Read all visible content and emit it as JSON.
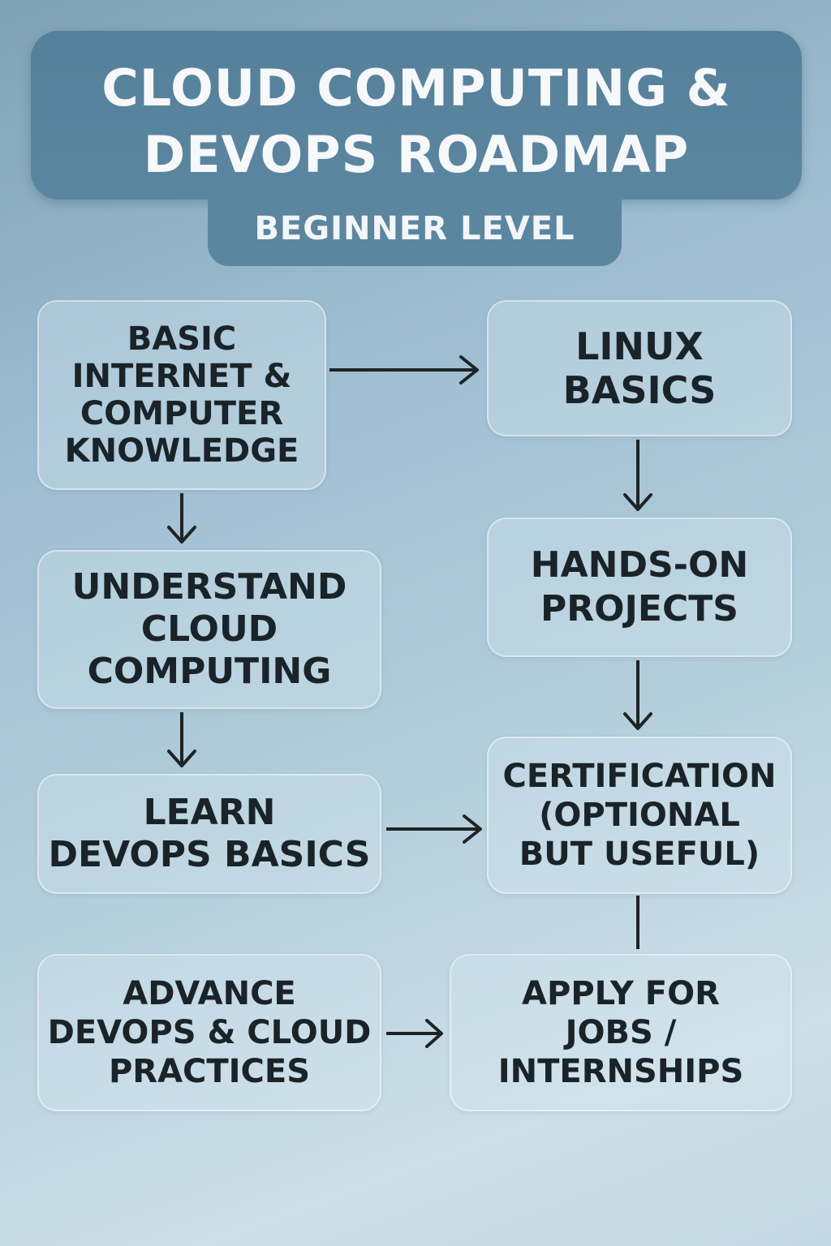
{
  "header": {
    "title_line1": "CLOUD COMPUTING &",
    "title_line2": "DEVOPS ROADMAP",
    "subtitle": "BEGINNER LEVEL"
  },
  "nodes": [
    {
      "id": "basic",
      "lines": [
        "BASIC",
        "INTERNET &",
        "COMPUTER",
        "KNOWLEDGE"
      ]
    },
    {
      "id": "linux",
      "lines": [
        "LINUX",
        "BASICS"
      ]
    },
    {
      "id": "cloud",
      "lines": [
        "UNDERSTAND",
        "CLOUD",
        "COMPUTING"
      ]
    },
    {
      "id": "handson",
      "lines": [
        "HANDS-ON",
        "PROJECTS"
      ]
    },
    {
      "id": "devops",
      "lines": [
        "LEARN",
        "DEVOPS BASICS"
      ]
    },
    {
      "id": "cert",
      "lines": [
        "CERTIFICATION",
        "(OPTIONAL",
        "BUT USEFUL)"
      ]
    },
    {
      "id": "advance",
      "lines": [
        "ADVANCE",
        "DEVOPS & CLOUD",
        "PRACTICES"
      ]
    },
    {
      "id": "apply",
      "lines": [
        "APPLY FOR",
        "JOBS /",
        "INTERNSHIPS"
      ]
    }
  ],
  "connections": [
    {
      "from": "basic",
      "to": "linux",
      "arrow": true
    },
    {
      "from": "basic",
      "to": "cloud",
      "arrow": true
    },
    {
      "from": "linux",
      "to": "handson",
      "arrow": true
    },
    {
      "from": "cloud",
      "to": "devops",
      "arrow": true
    },
    {
      "from": "handson",
      "to": "cert",
      "arrow": true
    },
    {
      "from": "devops",
      "to": "cert",
      "arrow": true
    },
    {
      "from": "cert",
      "to": "apply",
      "arrow": false
    },
    {
      "from": "advance",
      "to": "apply",
      "arrow": true
    }
  ],
  "colors": {
    "background": "#a9c6d6",
    "header": "#55809b",
    "title_text": "#f6f8fa",
    "node_text": "#1a2328",
    "arrow": "#1e2326"
  }
}
